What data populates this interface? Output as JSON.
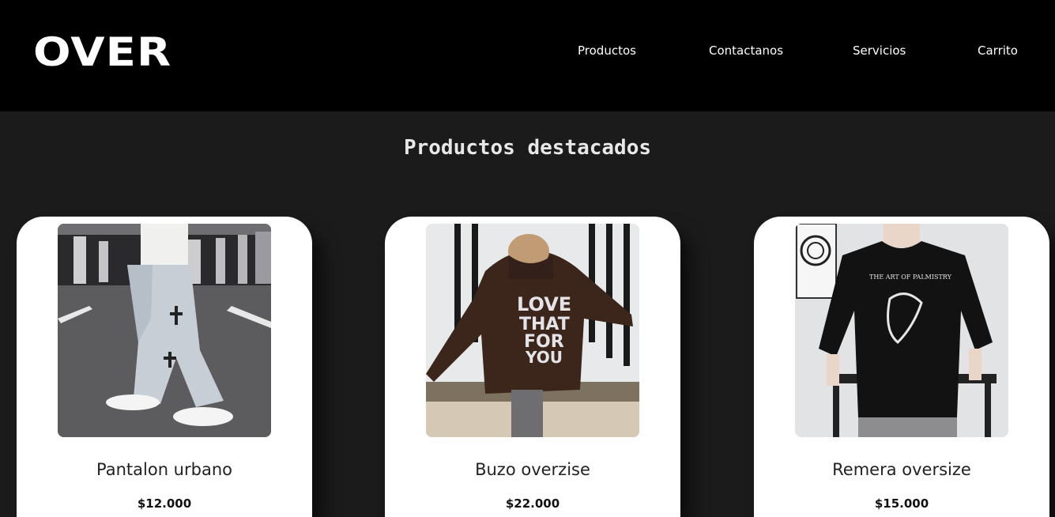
{
  "brand": {
    "logo": "OVER"
  },
  "nav": [
    {
      "label": "Productos"
    },
    {
      "label": "Contactanos"
    },
    {
      "label": "Servicios"
    },
    {
      "label": "Carrito"
    }
  ],
  "featured": {
    "title": "Productos destacados",
    "products": [
      {
        "name": "Pantalon urbano",
        "price": "$12.000",
        "image": "light-wash-jeans-photo"
      },
      {
        "name": "Buzo overzise",
        "price": "$22.000",
        "image": "brown-hoodie-photo"
      },
      {
        "name": "Remera oversize",
        "price": "$15.000",
        "image": "black-tshirt-photo"
      }
    ]
  },
  "colors": {
    "header_bg": "#000000",
    "page_bg": "#1c1b1c",
    "card_bg": "#ffffff"
  }
}
